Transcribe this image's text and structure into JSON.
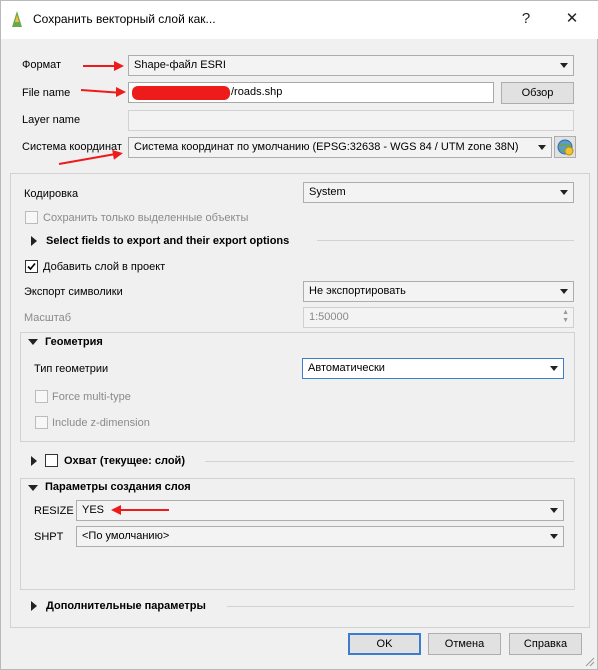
{
  "window": {
    "title": "Сохранить векторный слой как...",
    "help_glyph": "?",
    "close_glyph": "✕"
  },
  "format": {
    "label": "Формат",
    "value": "Shape-файл ESRI"
  },
  "file_name": {
    "label": "File name",
    "value": "/roads.shp",
    "browse": "Обзор"
  },
  "layer_name": {
    "label": "Layer name",
    "value": ""
  },
  "crs": {
    "label": "Система координат",
    "value": "Система координат по умолчанию (EPSG:32638 - WGS 84 / UTM zone 38N)"
  },
  "encoding": {
    "label": "Кодировка",
    "value": "System"
  },
  "save_selected": {
    "label": "Сохранить только выделенные объекты",
    "checked": false
  },
  "select_fields": {
    "label": "Select fields to export and their export options"
  },
  "add_layer": {
    "label": "Добавить слой в проект",
    "checked": true
  },
  "symbology_export": {
    "label": "Экспорт символики",
    "value": "Не экспортировать"
  },
  "scale": {
    "label": "Масштаб",
    "value": "1:50000"
  },
  "geometry": {
    "label": "Геометрия",
    "type_label": "Тип геометрии",
    "type_value": "Автоматически",
    "force_multi": "Force multi-type",
    "include_z": "Include z-dimension"
  },
  "extent": {
    "label": "Охват (текущее: слой)"
  },
  "layer_options": {
    "label": "Параметры создания слоя",
    "resize_label": "RESIZE",
    "resize_value": "YES",
    "shpt_label": "SHPT",
    "shpt_value": "<По умолчанию>"
  },
  "advanced": {
    "label": "Дополнительные параметры"
  },
  "buttons": {
    "ok": "OK",
    "cancel": "Отмена",
    "help": "Справка"
  },
  "colors": {
    "annotation": "#ee1b1b",
    "accent": "#3b7cd1"
  }
}
